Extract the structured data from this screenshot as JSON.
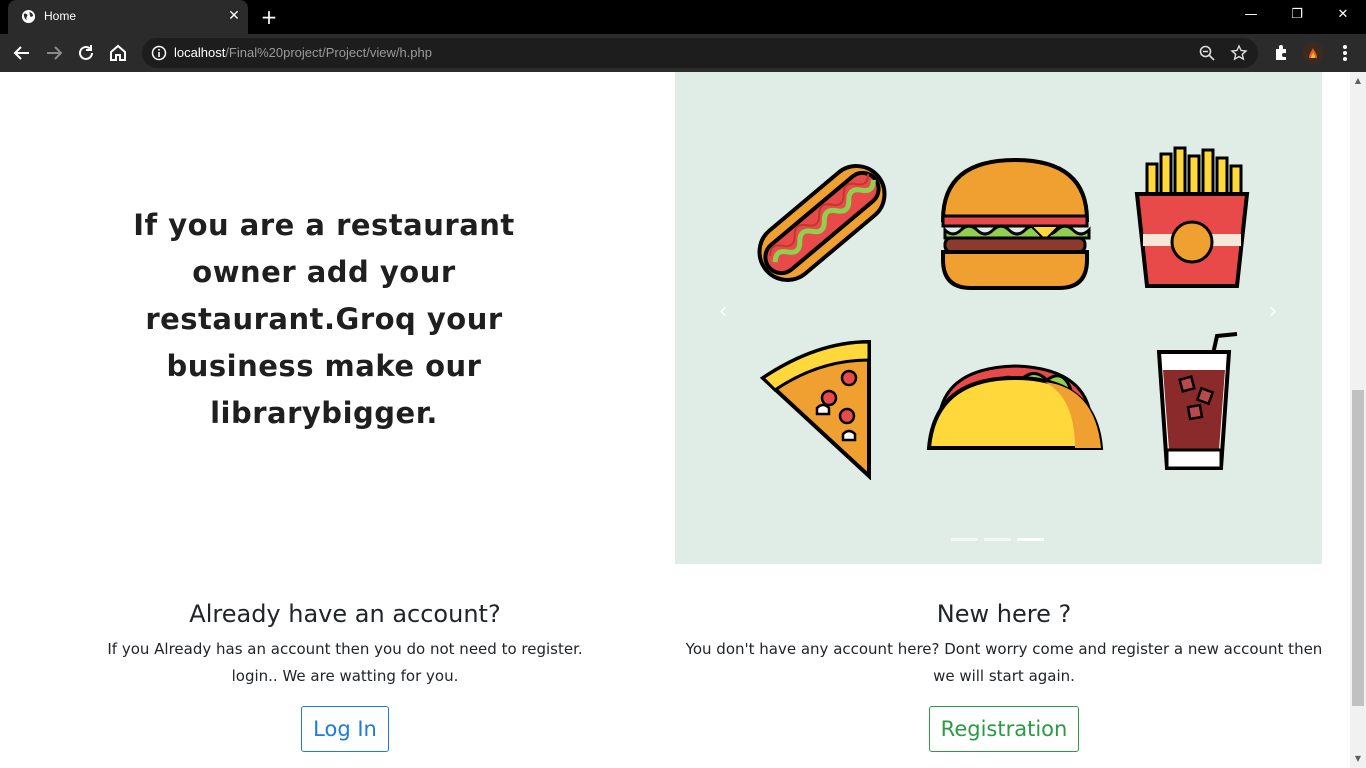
{
  "browser": {
    "tab_title": "Home",
    "tab_close": "✕",
    "new_tab": "+",
    "url_host": "localhost",
    "url_path": "/Final%20project/Project/view/h.php",
    "window_controls": {
      "minimize": "—",
      "restore": "❐",
      "close": "✕"
    }
  },
  "hero": {
    "text": "If you are a restaurant owner add your restaurant.Groq your business make our librarybigger."
  },
  "carousel": {
    "prev": "‹",
    "next": "›",
    "indicator_count": 3,
    "active_index": 2,
    "background": "#e0ede7",
    "items": [
      "hotdog-icon",
      "burger-icon",
      "fries-icon",
      "pizza-slice-icon",
      "taco-icon",
      "soda-cup-icon"
    ]
  },
  "login_section": {
    "title": "Already have an account?",
    "description": "If you Already has an account then you do not need to register. login.. We are watting for you.",
    "button": "Log In",
    "color": "#1b7be0"
  },
  "register_section": {
    "title": "New here ?",
    "description": "You don't have any account here? Dont worry come and register a new account then we will start again.",
    "button": "Registration",
    "color": "#2a9a44"
  }
}
